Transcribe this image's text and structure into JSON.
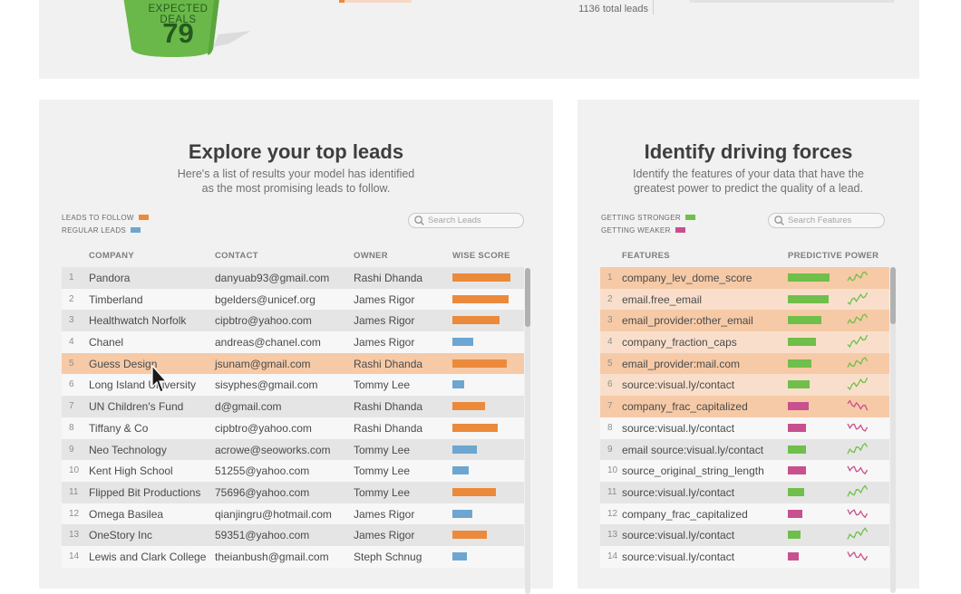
{
  "top": {
    "bucket_label": "EXPECTED DEALS",
    "bucket_value": "79",
    "total_leads": "1136 total leads"
  },
  "leads_panel": {
    "title": "Explore your top leads",
    "subtitle": [
      "Here's a list of results your model has identified",
      "as the most promising leads to follow."
    ],
    "legend": [
      {
        "label": "LEADS TO FOLLOW",
        "color": "#ec8a3c"
      },
      {
        "label": "REGULAR LEADS",
        "color": "#6da6d0"
      }
    ],
    "search_placeholder": "Search Leads",
    "columns": [
      "COMPANY",
      "CONTACT",
      "OWNER",
      "WISE SCORE"
    ],
    "rows": [
      {
        "n": "1",
        "company": "Pandora",
        "contact": "danyuab93@gmail.com",
        "owner": "Rashi Dhanda",
        "score": 0.96,
        "follow": true
      },
      {
        "n": "2",
        "company": "Timberland",
        "contact": "bgelders@unicef.org",
        "owner": "James Rigor",
        "score": 0.93,
        "follow": true
      },
      {
        "n": "3",
        "company": "Healthwatch Norfolk",
        "contact": "cipbtro@yahoo.com",
        "owner": "James Rigor",
        "score": 0.77,
        "follow": true
      },
      {
        "n": "4",
        "company": "Chanel",
        "contact": "andreas@chanel.com",
        "owner": "James Rigor",
        "score": 0.35,
        "follow": false
      },
      {
        "n": "5",
        "company": "Guess Design",
        "contact": "jsunam@gmail.com",
        "owner": "Rashi Dhanda",
        "score": 0.89,
        "follow": true,
        "highlight": true
      },
      {
        "n": "6",
        "company": "Long Island University",
        "contact": "sisyphes@gmail.com",
        "owner": "Tommy Lee",
        "score": 0.2,
        "follow": false
      },
      {
        "n": "7",
        "company": "UN Children's Fund",
        "contact": "d@gmail.com",
        "owner": "Rashi Dhanda",
        "score": 0.53,
        "follow": true
      },
      {
        "n": "8",
        "company": "Tiffany & Co",
        "contact": "cipbtro@yahoo.com",
        "owner": "Rashi Dhanda",
        "score": 0.74,
        "follow": true
      },
      {
        "n": "9",
        "company": "Neo Technology",
        "contact": "acrowe@seoworks.com",
        "owner": "Tommy Lee",
        "score": 0.41,
        "follow": false
      },
      {
        "n": "10",
        "company": "Kent High School",
        "contact": "51255@yahoo.com",
        "owner": "Tommy Lee",
        "score": 0.27,
        "follow": false
      },
      {
        "n": "11",
        "company": "Flipped Bit Productions",
        "contact": "75696@yahoo.com",
        "owner": "Tommy Lee",
        "score": 0.71,
        "follow": true
      },
      {
        "n": "12",
        "company": "Omega Basilea",
        "contact": "qianjingru@hotmail.com",
        "owner": "James Rigor",
        "score": 0.33,
        "follow": false
      },
      {
        "n": "13",
        "company": "OneStory Inc",
        "contact": "59351@yahoo.com",
        "owner": "James Rigor",
        "score": 0.57,
        "follow": true
      },
      {
        "n": "14",
        "company": "Lewis and Clark College",
        "contact": "theianbush@gmail.com",
        "owner": "Steph Schnug",
        "score": 0.24,
        "follow": false
      }
    ]
  },
  "forces_panel": {
    "title": "Identify driving forces",
    "subtitle": [
      "Identify the features of your data that have the",
      "greatest power to predict the quality of a lead."
    ],
    "legend": [
      {
        "label": "GETTING STRONGER",
        "color": "#6fbf4a"
      },
      {
        "label": "GETTING WEAKER",
        "color": "#c8508f"
      }
    ],
    "search_placeholder": "Search Features",
    "columns": [
      "FEATURES",
      "PREDICTIVE POWER"
    ],
    "rows": [
      {
        "n": "1",
        "feature": "company_lev_dome_score",
        "power": 0.98,
        "trend": "stronger",
        "bg": "dark"
      },
      {
        "n": "2",
        "feature": "email.free_email",
        "power": 0.95,
        "trend": "stronger",
        "bg": "light"
      },
      {
        "n": "3",
        "feature": "email_provider:other_email",
        "power": 0.78,
        "trend": "stronger",
        "bg": "dark"
      },
      {
        "n": "4",
        "feature": "company_fraction_caps",
        "power": 0.65,
        "trend": "stronger",
        "bg": "light"
      },
      {
        "n": "5",
        "feature": "email_provider:mail.com",
        "power": 0.55,
        "trend": "stronger",
        "bg": "dark"
      },
      {
        "n": "6",
        "feature": "source:visual.ly/contact",
        "power": 0.5,
        "trend": "stronger",
        "bg": "light"
      },
      {
        "n": "7",
        "feature": "company_frac_capitalized",
        "power": 0.48,
        "trend": "weaker",
        "bg": "dark"
      },
      {
        "n": "8",
        "feature": "source:visual.ly/contact",
        "power": 0.42,
        "trend": "weaker",
        "bg": "none"
      },
      {
        "n": "9",
        "feature": "email source:visual.ly/contact",
        "power": 0.42,
        "trend": "stronger",
        "bg": "none"
      },
      {
        "n": "10",
        "feature": "source_original_string_length",
        "power": 0.42,
        "trend": "weaker",
        "bg": "none"
      },
      {
        "n": "11",
        "feature": "source:visual.ly/contact",
        "power": 0.38,
        "trend": "stronger",
        "bg": "none"
      },
      {
        "n": "12",
        "feature": "company_frac_capitalized",
        "power": 0.34,
        "trend": "weaker",
        "bg": "none"
      },
      {
        "n": "13",
        "feature": "source:visual.ly/contact",
        "power": 0.3,
        "trend": "stronger",
        "bg": "none"
      },
      {
        "n": "14",
        "feature": "source:visual.ly/contact",
        "power": 0.26,
        "trend": "weaker",
        "bg": "none"
      }
    ]
  }
}
